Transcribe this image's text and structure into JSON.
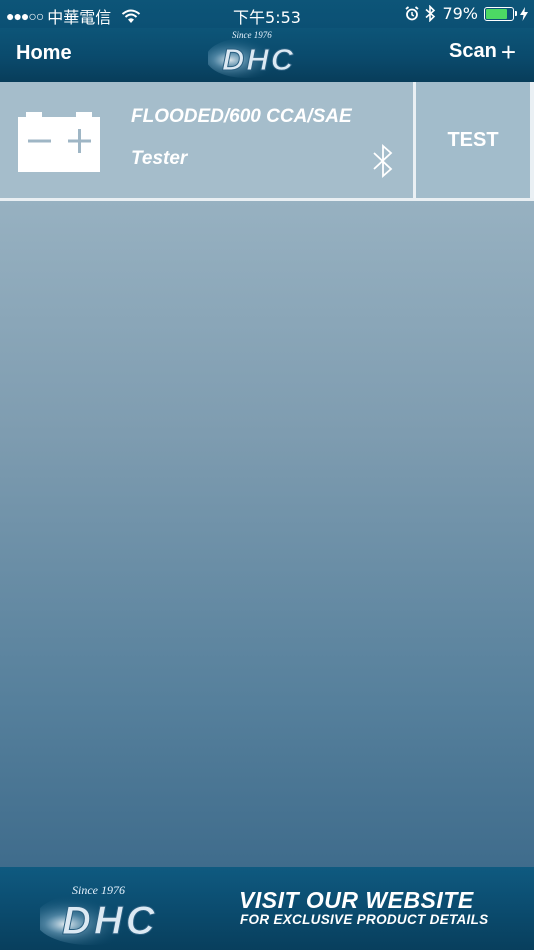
{
  "status_bar": {
    "signal": "●●●○○",
    "carrier": "中華電信",
    "time": "下午5:53",
    "battery_percent": "79%",
    "battery_level": 0.79,
    "battery_color": "#4cd964"
  },
  "nav": {
    "home_label": "Home",
    "scan_label": "Scan",
    "scan_icon": "plus-icon",
    "logo": {
      "since": "Since 1976",
      "brand": "DHC"
    }
  },
  "device": {
    "type": "FLOODED/600 CCA/SAE",
    "name": "Tester",
    "icon": "bluetooth-icon",
    "test_label": "TEST"
  },
  "banner": {
    "logo": {
      "since": "Since 1976",
      "brand": "DHC"
    },
    "title": "VISIT OUR WEBSITE",
    "subtitle": "FOR EXCLUSIVE PRODUCT DETAILS"
  },
  "colors": {
    "header_blue": "#0b4c6f",
    "row_background": "#a5bdcb",
    "content_top": "#97b1c1",
    "content_bottom": "#3f6c8c"
  }
}
